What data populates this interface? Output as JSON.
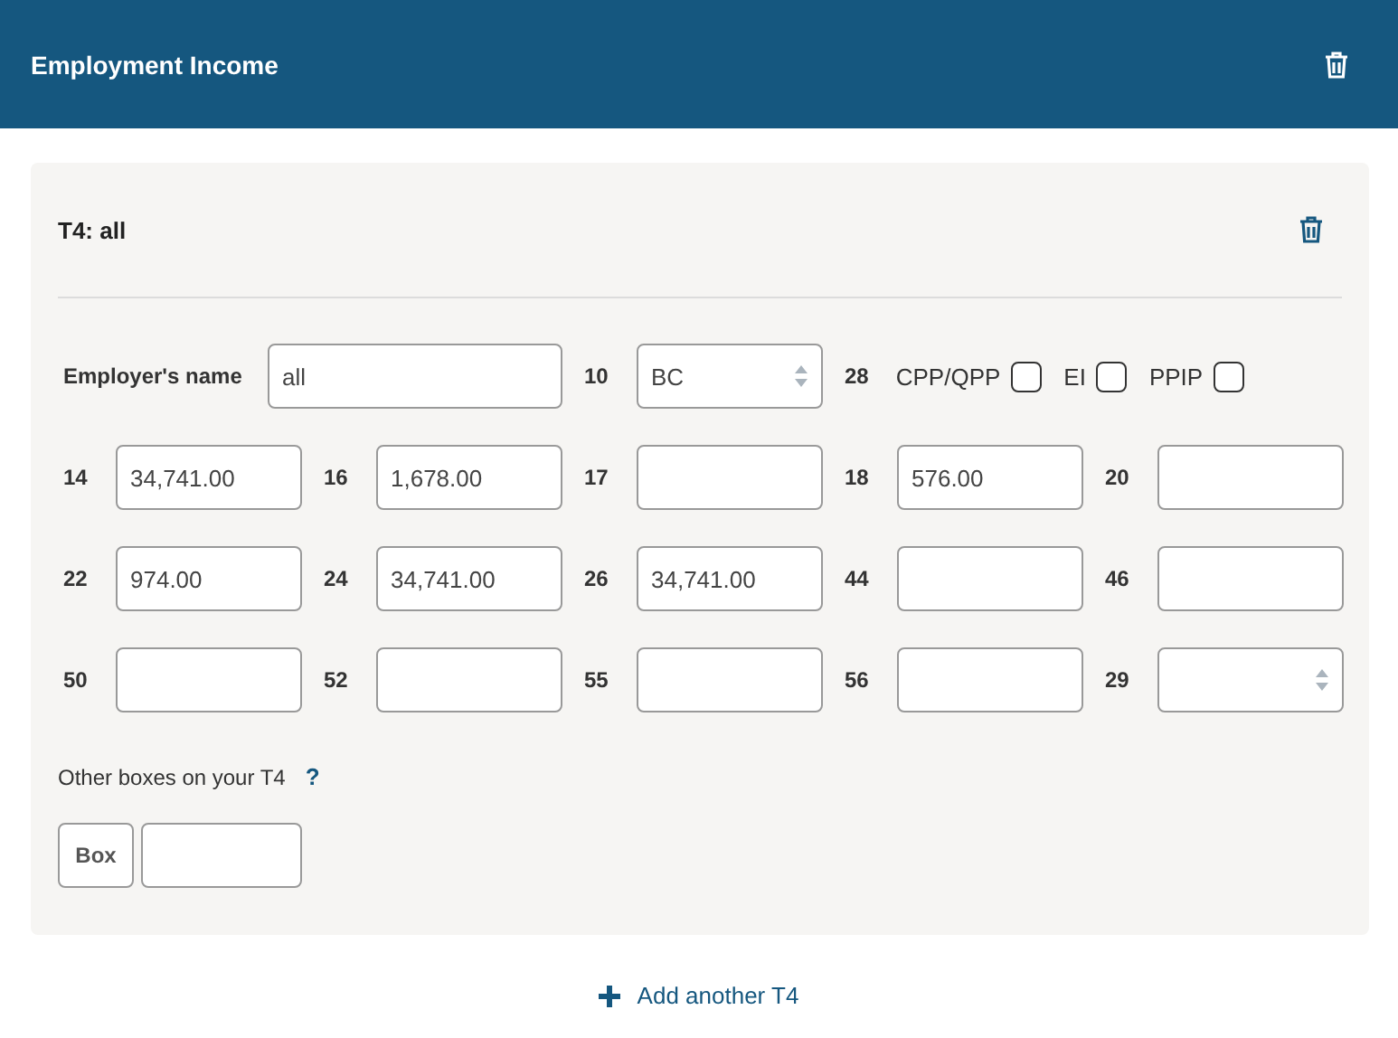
{
  "header": {
    "title": "Employment Income"
  },
  "slip": {
    "title": "T4: all",
    "employer": {
      "label": "Employer's name",
      "value": "all"
    },
    "province": {
      "label": "10",
      "value": "BC"
    },
    "box28": {
      "label": "28",
      "options": [
        {
          "label": "CPP/QPP",
          "checked": false
        },
        {
          "label": "EI",
          "checked": false
        },
        {
          "label": "PPIP",
          "checked": false
        }
      ]
    },
    "boxes": [
      {
        "label": "14",
        "kind": "text",
        "value": "34,741.00"
      },
      {
        "label": "16",
        "kind": "text",
        "value": "1,678.00"
      },
      {
        "label": "17",
        "kind": "text"
      },
      {
        "label": "18",
        "kind": "text",
        "value": "576.00"
      },
      {
        "label": "20",
        "kind": "text"
      },
      {
        "label": "22",
        "kind": "text",
        "value": "974.00"
      },
      {
        "label": "24",
        "kind": "text",
        "value": "34,741.00"
      },
      {
        "label": "26",
        "kind": "text",
        "value": "34,741.00"
      },
      {
        "label": "44",
        "kind": "text"
      },
      {
        "label": "46",
        "kind": "text"
      },
      {
        "label": "50",
        "kind": "text"
      },
      {
        "label": "52",
        "kind": "text"
      },
      {
        "label": "55",
        "kind": "text"
      },
      {
        "label": "56",
        "kind": "text"
      },
      {
        "label": "29",
        "kind": "select"
      }
    ],
    "other": {
      "label": "Other boxes on your T4",
      "help": "?",
      "box_label": "Box"
    }
  },
  "add_button": {
    "label": "Add another T4"
  }
}
